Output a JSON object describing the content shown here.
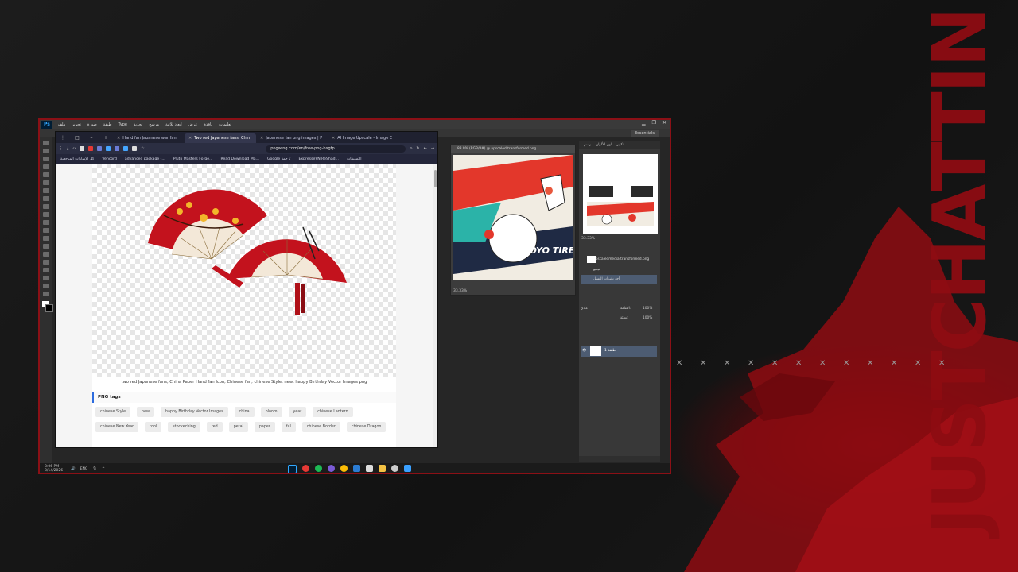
{
  "brand_text": "JUSTCHATTIN",
  "photoshop": {
    "logo": "Ps",
    "menu": [
      "ملف",
      "تحرير",
      "صورة",
      "طبقة",
      "Type",
      "تحديد",
      "مرشح",
      "أبعاد ثلاثية",
      "عرض",
      "نافذة",
      "تعليمات"
    ],
    "workspace_label": "Essentials",
    "document_title": "88.9% (RGB/8#) @ upscaled-transformed.png",
    "document_zoom": "33.33%",
    "navigator_zoom": "33.33%",
    "layers_mini": [
      "upscaledmedia-transformed.png",
      "فيديو",
      "أحد تأثيرات العسل"
    ],
    "blend_mode": "عادي",
    "opacity_label": "العتامة:",
    "opacity_value": "100%",
    "fill_label": "تعبئة:",
    "fill_value": "100%",
    "layer_name": "طبقة 1",
    "panel_tabs": [
      "رسم",
      "لون الألوان",
      "تكبير"
    ]
  },
  "browser": {
    "tabs": [
      {
        "label": "Hand fan Japanese war fan,"
      },
      {
        "label": "Two red Japanese fans, Chin",
        "active": true
      },
      {
        "label": "Japanese fan png images | P"
      },
      {
        "label": "AI Image Upscale - Image E"
      }
    ],
    "url": "pngwing.com/en/free-png-bxgfp",
    "bookmarks": [
      "كل الإشارات المرجعية",
      "Vencord",
      "advanced package -...",
      "Pluto Masters Forge...",
      "Read Download Ma...",
      "Google ترجمة",
      "ExpressVPN ReShad...",
      "التطبيقات"
    ],
    "caption": "two red Japanese fans, China Paper Hand fan Icon, Chinese fan, chinese Style, new, happy Birthday Vector Images png",
    "tags_heading": "PNG tags",
    "tags": [
      "chinese Style",
      "new",
      "happy Birthday Vector Images",
      "china",
      "bloom",
      "year",
      "chinese Lantern",
      "chinese New Year",
      "tool",
      "stockeching",
      "red",
      "petal",
      "paper",
      "fal",
      "chinese Border",
      "chinese Dragon"
    ]
  },
  "taskbar": {
    "time": "8:06 PM",
    "date": "8/14/2026",
    "lang": "ENG"
  },
  "colors": {
    "accent_red": "#8b1016",
    "fan_red": "#c3121d"
  }
}
